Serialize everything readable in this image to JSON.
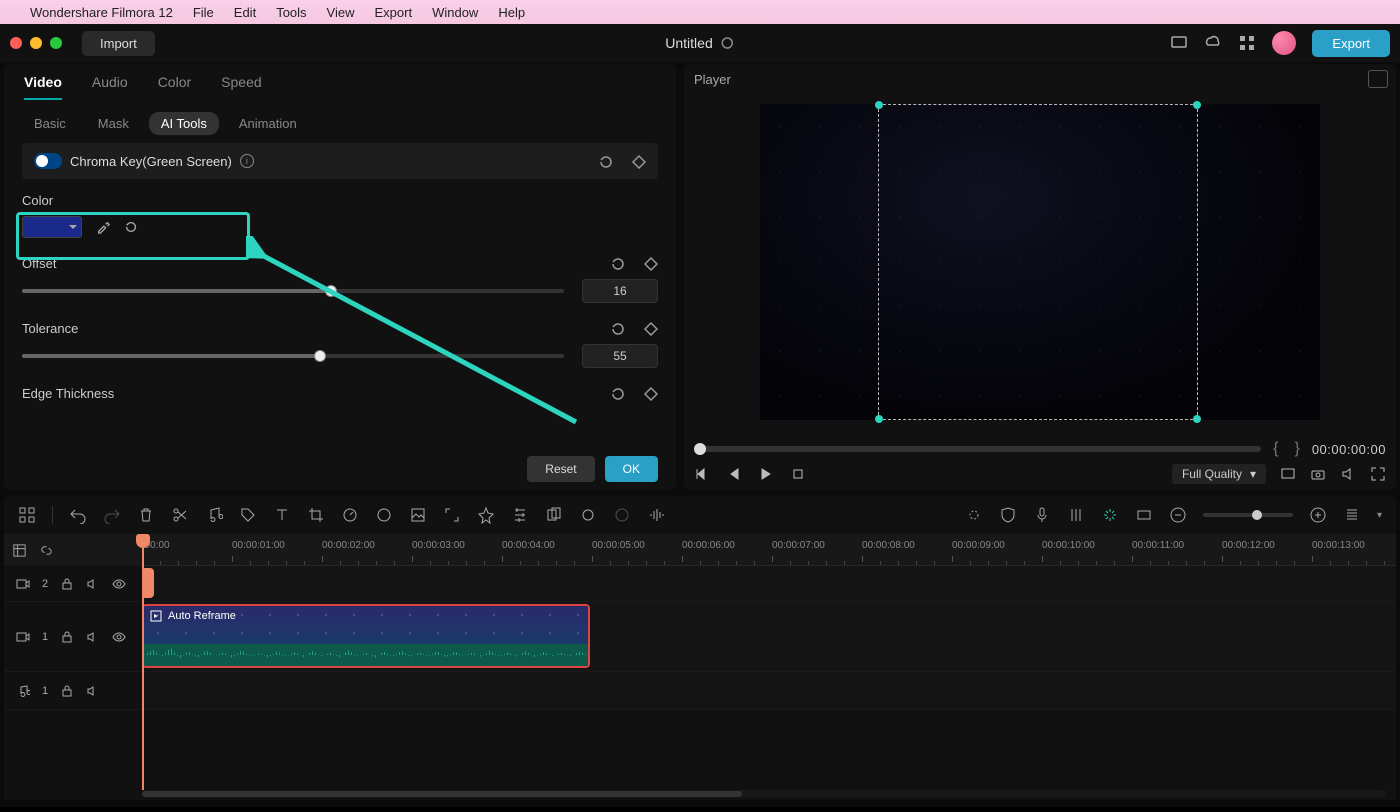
{
  "menubar": {
    "app": "Wondershare Filmora 12",
    "items": [
      "File",
      "Edit",
      "Tools",
      "View",
      "Export",
      "Window",
      "Help"
    ]
  },
  "titlebar": {
    "import": "Import",
    "project": "Untitled",
    "export": "Export"
  },
  "inspector": {
    "tabs_main": [
      "Video",
      "Audio",
      "Color",
      "Speed"
    ],
    "tabs_sub": [
      "Basic",
      "Mask",
      "AI Tools",
      "Animation"
    ],
    "chroma_label": "Chroma Key(Green Screen)",
    "color_label": "Color",
    "offset": {
      "label": "Offset",
      "value": "16",
      "pct": 57
    },
    "tolerance": {
      "label": "Tolerance",
      "value": "55",
      "pct": 55
    },
    "edge_thickness": {
      "label": "Edge Thickness"
    },
    "reset": "Reset",
    "ok": "OK"
  },
  "player": {
    "title": "Player",
    "timecode": "00:00:00:00",
    "quality": "Full Quality"
  },
  "timeline": {
    "ruler": [
      "|00:00",
      "00:00:01:00",
      "00:00:02:00",
      "00:00:03:00",
      "00:00:04:00",
      "00:00:05:00",
      "00:00:06:00",
      "00:00:07:00",
      "00:00:08:00",
      "00:00:09:00",
      "00:00:10:00",
      "00:00:11:00",
      "00:00:12:00",
      "00:00:13:00",
      "00:00"
    ],
    "track_v2": "2",
    "track_v1": "1",
    "track_a1": "1",
    "clip_label": "Auto Reframe"
  }
}
